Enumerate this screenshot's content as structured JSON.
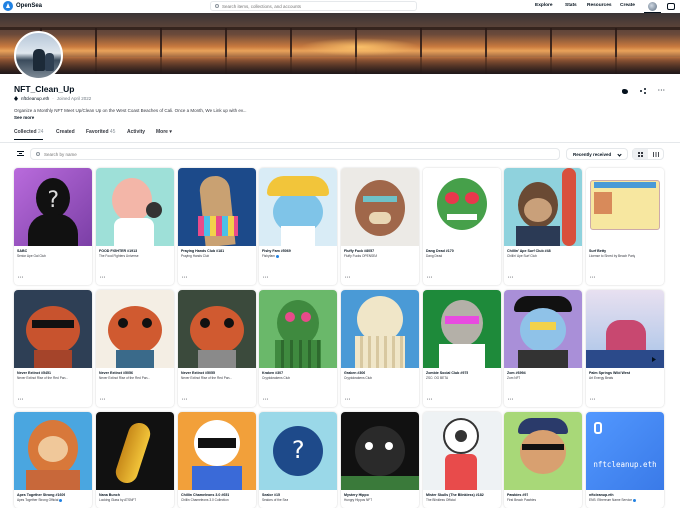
{
  "nav": {
    "logo_text": "OpenSea",
    "search_placeholder": "Search items, collections, and accounts",
    "links": [
      "Explore",
      "Stats",
      "Resources",
      "Create"
    ]
  },
  "profile": {
    "name": "NFT_Clean_Up",
    "address": "nftcleanup.eth",
    "joined": "Joined April 2022",
    "bio": "Organize a Monthly NFT Meet Up/Clean Up on the West Coast Beaches of Cali. Once a Month, We Link up with ev...",
    "see_more": "See more"
  },
  "tabs": [
    {
      "label": "Collected",
      "count": "24"
    },
    {
      "label": "Created",
      "count": ""
    },
    {
      "label": "Favorited",
      "count": "45"
    },
    {
      "label": "Activity",
      "count": ""
    },
    {
      "label": "More",
      "count": ""
    }
  ],
  "filters": {
    "search_placeholder": "Search by name",
    "sort_selected": "Recently received"
  },
  "cards": [
    {
      "name": "SABC",
      "collection": "Senior Ape Gal Club",
      "verified": false,
      "art": "silhouette"
    },
    {
      "name": "FOOD FIGHTER #1913",
      "collection": "The Food Fighters Universe",
      "verified": false,
      "art": "food"
    },
    {
      "name": "Praying Hands Club #181",
      "collection": "Praying Hands Club",
      "verified": false,
      "art": "hands"
    },
    {
      "name": "Fishy Fam #5069",
      "collection": "Fishyfam",
      "verified": true,
      "art": "fish"
    },
    {
      "name": "Fluffy Fuck #8057",
      "collection": "Fluffy Fucks OPENSEA",
      "verified": false,
      "art": "fluffy"
    },
    {
      "name": "Dang Dead #170",
      "collection": "Dang Dead",
      "verified": false,
      "art": "rat"
    },
    {
      "name": "Chillin' Ape Surf Club #48",
      "collection": "Chillin' Ape Surf Club",
      "verified": false,
      "art": "ape"
    },
    {
      "name": "Surf Betty",
      "collection": "License to Shred by Beach Party",
      "verified": false,
      "art": "license"
    },
    {
      "name": "Never Extinct #5451",
      "collection": "Never Extinct Rise of the Red Pan...",
      "verified": false,
      "art": "panda1"
    },
    {
      "name": "Never Extinct #5056",
      "collection": "Never Extinct Rise of the Red Pan...",
      "verified": false,
      "art": "panda2"
    },
    {
      "name": "Never Extinct #5055",
      "collection": "Never Extinct Rise of the Red Pan...",
      "verified": false,
      "art": "panda3"
    },
    {
      "name": "Kraken #307",
      "collection": "Cryptokrakens Club",
      "verified": false,
      "art": "kraken"
    },
    {
      "name": "Graken #306",
      "collection": "Cryptokrakens Club",
      "verified": false,
      "art": "graken"
    },
    {
      "name": "Zombie Social Club #975",
      "collection": "ZSC: OG BETA",
      "verified": false,
      "art": "zombie"
    },
    {
      "name": "Zom #6994",
      "collection": "Zom NFT",
      "verified": false,
      "art": "pirate"
    },
    {
      "name": "Palm Springs Wild West",
      "collection": "Art Energy Beats",
      "verified": false,
      "art": "palm"
    },
    {
      "name": "Apes Together Strong #1609",
      "collection": "Apes Together Strong Official",
      "verified": true,
      "art": "monkey"
    },
    {
      "name": "Nana Bunch",
      "collection": "Looking Glass by ATSNFT",
      "verified": false,
      "art": "banana"
    },
    {
      "name": "Chillin Chameleons 3.0 #651",
      "collection": "Chillin Chameleons 3.0 Collection",
      "verified": false,
      "art": "skull"
    },
    {
      "name": "Sealor #15",
      "collection": "Sealors of the Sea",
      "verified": false,
      "art": "question"
    },
    {
      "name": "Mystery Hippo",
      "collection": "Hungry Hippos NFT",
      "verified": false,
      "art": "hippo"
    },
    {
      "name": "Mister Skulls (The Blinkless) #182",
      "collection": "The Blinkless Official",
      "verified": false,
      "art": "eyeball"
    },
    {
      "name": "Pawbies #97",
      "collection": "First Beach Pawbies",
      "verified": false,
      "art": "dog"
    },
    {
      "name": "nftcleanup.eth",
      "collection": "ENS: Ethereum Name Service",
      "verified": true,
      "art": "ens"
    }
  ],
  "colors": {
    "accent": "#2081e2",
    "text": "#04111d",
    "border": "#e5e8eb",
    "muted": "#8a939b"
  },
  "icons": [
    "opensea-logo-icon",
    "search-icon",
    "avatar-icon",
    "wallet-icon",
    "eth-icon",
    "twitter-icon",
    "share-icon",
    "more-icon",
    "filter-icon",
    "chevron-down-icon",
    "grid-large-icon",
    "grid-small-icon",
    "next-arrow-icon"
  ]
}
